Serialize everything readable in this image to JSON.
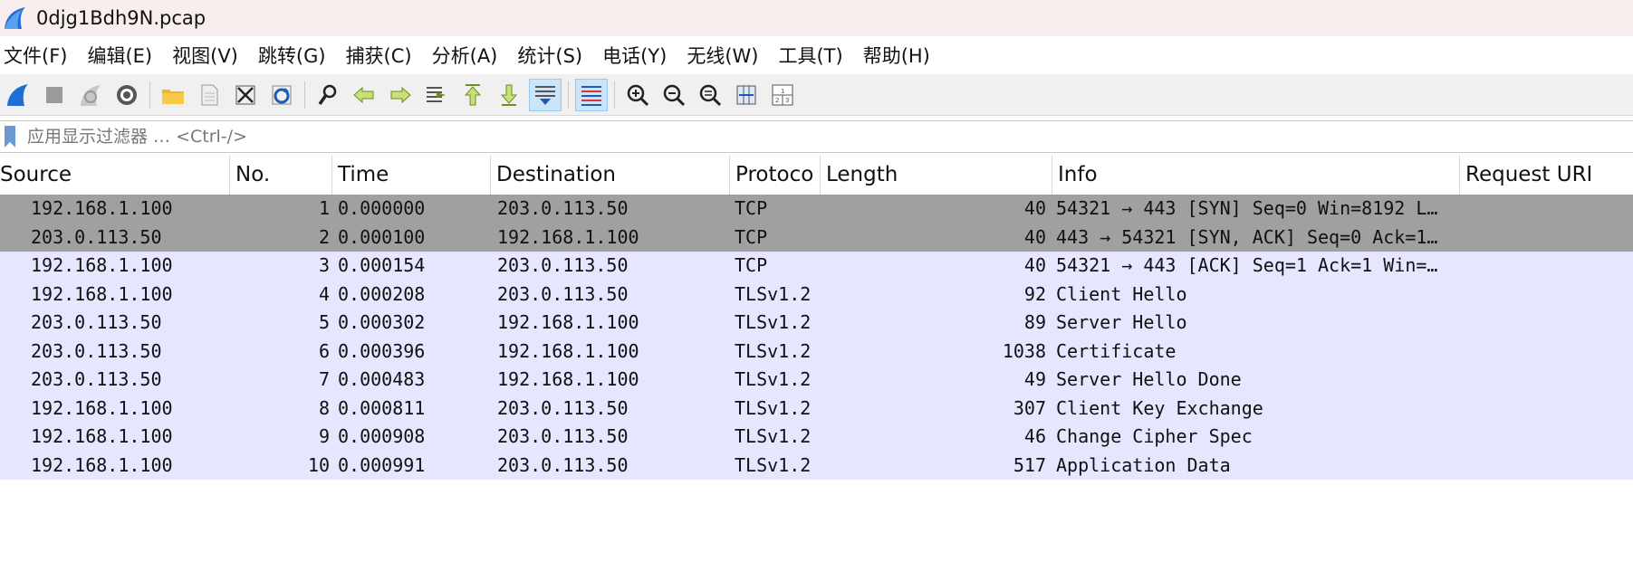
{
  "window": {
    "title": "0djg1Bdh9N.pcap"
  },
  "menu": [
    "文件(F)",
    "编辑(E)",
    "视图(V)",
    "跳转(G)",
    "捕获(C)",
    "分析(A)",
    "统计(S)",
    "电话(Y)",
    "无线(W)",
    "工具(T)",
    "帮助(H)"
  ],
  "toolbar": {
    "icons": [
      "start-capture-icon",
      "stop-capture-icon",
      "restart-capture-icon",
      "capture-options-icon",
      "open-file-icon",
      "save-file-icon",
      "close-file-icon",
      "reload-file-icon",
      "find-packet-icon",
      "go-back-icon",
      "go-forward-icon",
      "go-to-packet-icon",
      "go-first-icon",
      "go-last-icon",
      "auto-scroll-icon",
      "colorize-icon",
      "zoom-in-icon",
      "zoom-out-icon",
      "normal-size-icon",
      "resize-columns-icon",
      "layout-icon"
    ]
  },
  "filter": {
    "placeholder": "应用显示过滤器 … <Ctrl-/>"
  },
  "packet_list": {
    "columns": [
      "Source",
      "No.",
      "Time",
      "Destination",
      "Protoco",
      "Length",
      "Info",
      "Request URI"
    ],
    "rows": [
      {
        "source": "192.168.1.100",
        "no": "1",
        "time": "0.000000",
        "destination": "203.0.113.50",
        "protocol": "TCP",
        "length": "40",
        "info": "54321 → 443 [SYN] Seq=0 Win=8192 L…",
        "uri": "",
        "color": "tcp"
      },
      {
        "source": "203.0.113.50",
        "no": "2",
        "time": "0.000100",
        "destination": "192.168.1.100",
        "protocol": "TCP",
        "length": "40",
        "info": "443 → 54321 [SYN, ACK] Seq=0 Ack=1…",
        "uri": "",
        "color": "tcp"
      },
      {
        "source": "192.168.1.100",
        "no": "3",
        "time": "0.000154",
        "destination": "203.0.113.50",
        "protocol": "TCP",
        "length": "40",
        "info": "54321 → 443 [ACK] Seq=1 Ack=1 Win=…",
        "uri": "",
        "color": "tls"
      },
      {
        "source": "192.168.1.100",
        "no": "4",
        "time": "0.000208",
        "destination": "203.0.113.50",
        "protocol": "TLSv1.2",
        "length": "92",
        "info": "Client Hello",
        "uri": "",
        "color": "tls"
      },
      {
        "source": "203.0.113.50",
        "no": "5",
        "time": "0.000302",
        "destination": "192.168.1.100",
        "protocol": "TLSv1.2",
        "length": "89",
        "info": "Server Hello",
        "uri": "",
        "color": "tls"
      },
      {
        "source": "203.0.113.50",
        "no": "6",
        "time": "0.000396",
        "destination": "192.168.1.100",
        "protocol": "TLSv1.2",
        "length": "1038",
        "info": "Certificate",
        "uri": "",
        "color": "tls"
      },
      {
        "source": "203.0.113.50",
        "no": "7",
        "time": "0.000483",
        "destination": "192.168.1.100",
        "protocol": "TLSv1.2",
        "length": "49",
        "info": "Server Hello Done",
        "uri": "",
        "color": "tls"
      },
      {
        "source": "192.168.1.100",
        "no": "8",
        "time": "0.000811",
        "destination": "203.0.113.50",
        "protocol": "TLSv1.2",
        "length": "307",
        "info": "Client Key Exchange",
        "uri": "",
        "color": "tls"
      },
      {
        "source": "192.168.1.100",
        "no": "9",
        "time": "0.000908",
        "destination": "203.0.113.50",
        "protocol": "TLSv1.2",
        "length": "46",
        "info": "Change Cipher Spec",
        "uri": "",
        "color": "tls"
      },
      {
        "source": "192.168.1.100",
        "no": "10",
        "time": "0.000991",
        "destination": "203.0.113.50",
        "protocol": "TLSv1.2",
        "length": "517",
        "info": "Application Data",
        "uri": "",
        "color": "tls"
      }
    ]
  },
  "colors": {
    "tcp_row": "#a0a0a0",
    "tls_row": "#e7e6ff",
    "titlebar": "#f9eeee",
    "accent": "#1e6ed6"
  }
}
